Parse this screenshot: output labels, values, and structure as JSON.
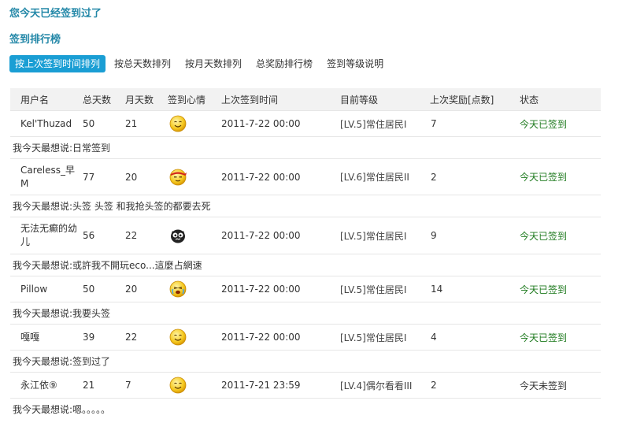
{
  "notice": "您今天已经签到过了",
  "rank_title": "签到排行榜",
  "tabs": [
    "按上次签到时间排列",
    "按总天数排列",
    "按月天数排列",
    "总奖励排行榜",
    "签到等级说明"
  ],
  "columns": [
    "用户名",
    "总天数",
    "月天数",
    "签到心情",
    "上次签到时间",
    "目前等级",
    "上次奖励[点数]",
    "状态"
  ],
  "rows": [
    {
      "user": "Kel'Thuzad",
      "total": "50",
      "month": "21",
      "mood": "smile-face-icon",
      "time": "2011-7-22 00:00",
      "level": "[LV.5]常住居民I",
      "reward": "7",
      "status": "今天已签到",
      "say": "我今天最想说:日常签到"
    },
    {
      "user": "Careless_早M",
      "total": "77",
      "month": "20",
      "mood": "headband-face-icon",
      "time": "2011-7-22 00:00",
      "level": "[LV.6]常住居民II",
      "reward": "2",
      "status": "今天已签到",
      "say": "我今天最想说:头签 头签 和我抢头签的都要去死"
    },
    {
      "user": "无法无癫的幼儿",
      "total": "56",
      "month": "22",
      "mood": "black-monster-face-icon",
      "time": "2011-7-22 00:00",
      "level": "[LV.5]常住居民I",
      "reward": "9",
      "status": "今天已签到",
      "say": "我今天最想说:或許我不開玩eco...這麼占網速"
    },
    {
      "user": "Pillow",
      "total": "50",
      "month": "20",
      "mood": "crying-face-icon",
      "time": "2011-7-22 00:00",
      "level": "[LV.5]常住居民I",
      "reward": "14",
      "status": "今天已签到",
      "say": "我今天最想说:我要头签"
    },
    {
      "user": "嘎嘎",
      "total": "39",
      "month": "22",
      "mood": "smile-face-icon",
      "time": "2011-7-22 00:00",
      "level": "[LV.5]常住居民I",
      "reward": "4",
      "status": "今天已签到",
      "say": "我今天最想说:签到过了"
    },
    {
      "user": "永江依⑨",
      "total": "21",
      "month": "7",
      "mood": "smile-face-icon",
      "time": "2011-7-21 23:59",
      "level": "[LV.4]偶尔看看III",
      "reward": "2",
      "status": "今天未签到",
      "say": "我今天最想说:嗯。。。。。"
    }
  ],
  "colors": {
    "accent": "#1a9ed4",
    "title": "#2488a8",
    "status_ok": "#1e7a1e"
  }
}
